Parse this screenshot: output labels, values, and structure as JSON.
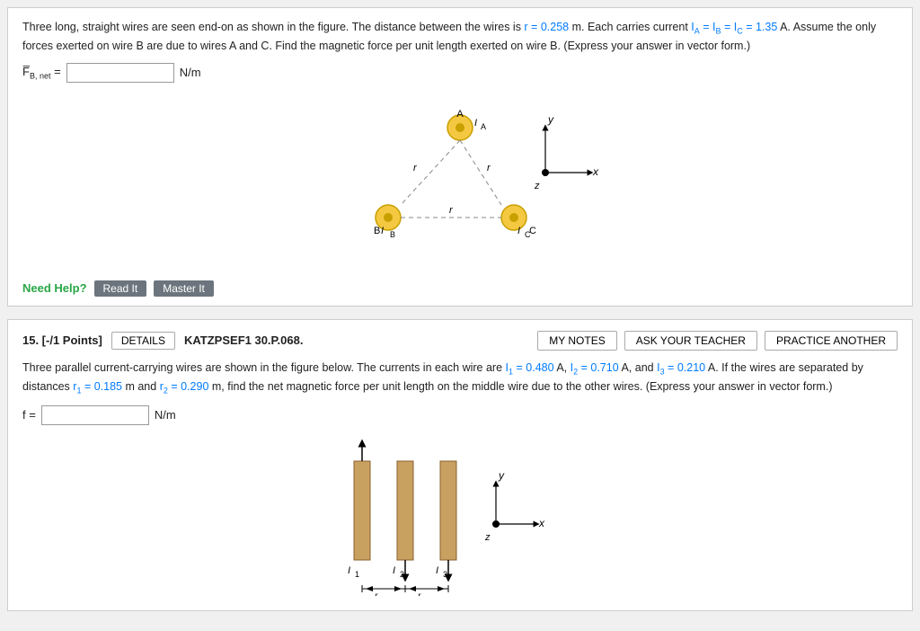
{
  "problem_top": {
    "description_parts": [
      "Three long, straight wires are seen end-on as shown in the figure. The distance between the wires is ",
      "r = 0.258",
      " m. Each carries current ",
      "I_A = I_B = I_C = 1.35",
      " A. Assume the only forces exerted on wire B are due to wires A and C. Find the magnetic force per unit length exerted on wire B. (Express your answer in vector form.)"
    ],
    "answer_label": "F̄_B, net =",
    "answer_placeholder": "",
    "unit": "N/m",
    "need_help": "Need Help?",
    "btn_read": "Read It",
    "btn_master": "Master It"
  },
  "problem15": {
    "number": "15. [-/1 Points]",
    "btn_details": "DETAILS",
    "code": "KATZPSEF1 30.P.068.",
    "btn_notes": "MY NOTES",
    "btn_ask": "ASK YOUR TEACHER",
    "btn_practice": "PRACTICE ANOTHER",
    "description_parts": [
      "Three parallel current-carrying wires are shown in the figure below. The currents in each wire are ",
      "I_1 = 0.480",
      " A, ",
      "I_2 = 0.710",
      " A, and ",
      "I_3 = 0.210",
      " A. If the wires are separated by distances ",
      "r_1 = 0.185",
      " m and ",
      "r_2 = 0.290",
      " m, find the net magnetic force per unit length on the middle wire due to the other wires. (Express your answer in vector form.)"
    ],
    "answer_label": "f =",
    "answer_placeholder": "",
    "unit": "N/m"
  }
}
